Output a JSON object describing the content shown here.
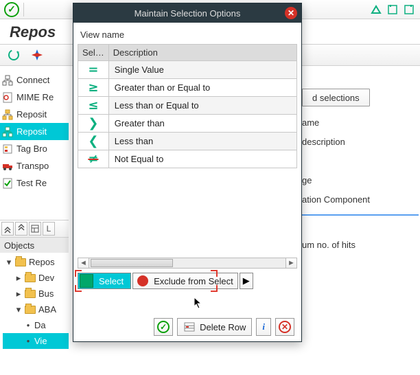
{
  "title_row": "Repos",
  "sidebar": {
    "items": [
      {
        "label": "Connect"
      },
      {
        "label": "MIME Re"
      },
      {
        "label": "Reposit"
      },
      {
        "label": "Reposit"
      },
      {
        "label": "Tag Bro"
      },
      {
        "label": "Transpo"
      },
      {
        "label": "Test Re"
      }
    ]
  },
  "objects_header": "Objects",
  "tree": {
    "rows": [
      {
        "label": "Repos",
        "indent": 0,
        "type": "folder",
        "exp": "open"
      },
      {
        "label": "Dev",
        "indent": 1,
        "type": "folder",
        "exp": "closed"
      },
      {
        "label": "Bus",
        "indent": 1,
        "type": "folder",
        "exp": "closed"
      },
      {
        "label": "ABA",
        "indent": 1,
        "type": "folder",
        "exp": "open"
      },
      {
        "label": "Da",
        "indent": 2,
        "type": "leaf"
      },
      {
        "label": "Vie",
        "indent": 2,
        "type": "leaf",
        "sel": true
      }
    ]
  },
  "bg_col": {
    "btn": "d selections",
    "rows": [
      "ame",
      "description",
      "ge",
      "ation Component"
    ],
    "hits": "um no. of hits"
  },
  "dialog": {
    "title": "Maintain Selection Options",
    "view_name": "View name",
    "cols": {
      "sel": "Sel…",
      "desc": "Description"
    },
    "rows": [
      {
        "sym": "=",
        "sym_class": "green",
        "desc": "Single Value"
      },
      {
        "sym": "≥",
        "sym_class": "green",
        "desc": "Greater than or Equal to"
      },
      {
        "sym": "≤",
        "sym_class": "green",
        "desc": "Less than or Equal to"
      },
      {
        "sym": "❯",
        "sym_class": "green",
        "desc": "Greater than"
      },
      {
        "sym": "❮",
        "sym_class": "green",
        "desc": "Less than"
      },
      {
        "sym": "≠",
        "sym_class": "green strike",
        "desc": "Not Equal to"
      }
    ],
    "select_label": "Select",
    "exclude_label": "Exclude from Select",
    "delete_row": "Delete Row"
  }
}
